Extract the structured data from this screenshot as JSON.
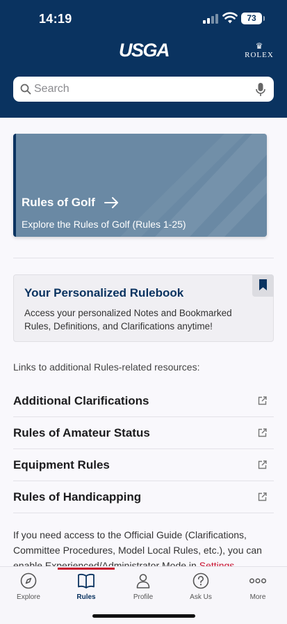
{
  "status": {
    "time": "14:19",
    "battery": "73"
  },
  "header": {
    "logo": "USGA",
    "sponsor": "ROLEX"
  },
  "search": {
    "placeholder": "Search"
  },
  "hero": {
    "title": "Rules of Golf",
    "description": "Explore the Rules of Golf (Rules 1-25)"
  },
  "rulebook": {
    "title": "Your Personalized Rulebook",
    "description": "Access your personalized Notes and Bookmarked Rules, Definitions, and Clarifications anytime!"
  },
  "links_intro": "Links to additional Rules-related resources:",
  "resources": [
    {
      "label": "Additional Clarifications"
    },
    {
      "label": "Rules of Amateur Status"
    },
    {
      "label": "Equipment Rules"
    },
    {
      "label": "Rules of Handicapping"
    }
  ],
  "footnote": {
    "text": "If you need access to the Official Guide (Clarifications, Committee Procedures, Model Local Rules, etc.), you can enable Experienced/Administrator Mode in",
    "link": "Settings"
  },
  "tabs": [
    {
      "label": "Explore",
      "icon": "compass-icon"
    },
    {
      "label": "Rules",
      "icon": "book-icon",
      "active": true
    },
    {
      "label": "Profile",
      "icon": "person-icon"
    },
    {
      "label": "Ask Us",
      "icon": "question-icon"
    },
    {
      "label": "More",
      "icon": "ellipsis-icon"
    }
  ],
  "colors": {
    "header": "#0a3360",
    "accent": "#c8102e",
    "hero": "#6a89a4"
  }
}
